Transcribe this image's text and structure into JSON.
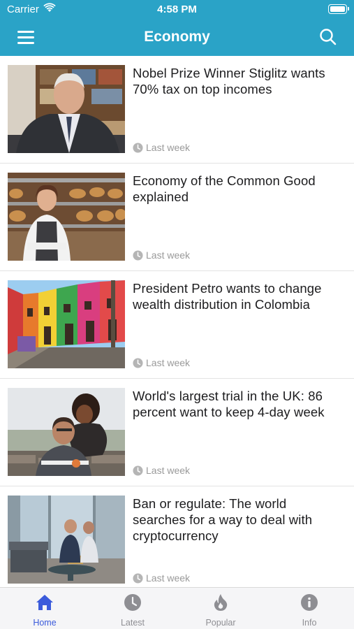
{
  "status_bar": {
    "carrier": "Carrier",
    "time": "4:58 PM"
  },
  "nav": {
    "title": "Economy"
  },
  "articles": [
    {
      "title": "Nobel Prize Winner Stiglitz wants 70% tax on top incomes",
      "time": "Last week",
      "image": "photo-economist-portrait"
    },
    {
      "title": "Economy of the Common Good explained",
      "time": "Last week",
      "image": "photo-bakery-worker"
    },
    {
      "title": "President Petro wants to change wealth distribution in Colombia",
      "time": "Last week",
      "image": "photo-colorful-street"
    },
    {
      "title": "World's largest trial in the UK: 86 percent want to keep 4-day week",
      "time": "Last week",
      "image": "photo-couple-hugging"
    },
    {
      "title": "Ban or regulate: The world searches for a way to deal with cryptocurrency",
      "time": "Last week",
      "image": "photo-office-meeting"
    }
  ],
  "tabs": [
    {
      "label": "Home",
      "icon": "home-icon",
      "active": true
    },
    {
      "label": "Latest",
      "icon": "clock-icon",
      "active": false
    },
    {
      "label": "Popular",
      "icon": "flame-icon",
      "active": false
    },
    {
      "label": "Info",
      "icon": "info-icon",
      "active": false
    }
  ],
  "colors": {
    "header": "#2aa3c7",
    "active_tab": "#3b5bdb",
    "inactive_tab": "#8e8e93",
    "meta_text": "#9a9a9a"
  }
}
